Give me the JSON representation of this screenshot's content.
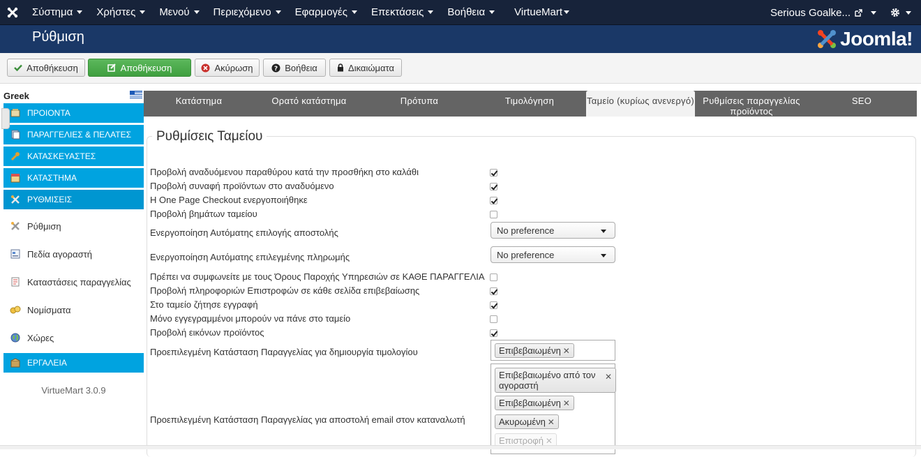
{
  "topnav": {
    "menu": [
      "Σύστημα",
      "Χρήστες",
      "Μενού",
      "Περιεχόμενο",
      "Εφαρμογές",
      "Επεκτάσεις",
      "Βοήθεια",
      "VirtueMart"
    ],
    "user": "Serious Goalke...",
    "icons": [
      "joomla-icon",
      "external-link-icon",
      "gear-icon"
    ]
  },
  "header": {
    "title": "Ρύθμιση",
    "brand": "Joomla!"
  },
  "toolbar": {
    "apply": "Αποθήκευση",
    "save": "Αποθήκευση",
    "cancel": "Ακύρωση",
    "help": "Βοήθεια",
    "permissions": "Δικαιώματα"
  },
  "sidebar": {
    "language": "Greek",
    "sections": {
      "products": "ΠΡΟΙΟΝΤΑ",
      "orders": "ΠΑΡΑΓΓΕΛΙΕΣ & ΠΕΛΑΤΕΣ",
      "manufacturers": "ΚΑΤΑΣΚΕΥΑΣΤΕΣ",
      "shop": "ΚΑΤΑΣΤΗΜΑ",
      "settings": "ΡΥΘΜΙΣΕΙΣ",
      "tools": "ΕΡΓΑΛΕΙΑ"
    },
    "items": [
      "Ρύθμιση",
      "Πεδία αγοραστή",
      "Καταστάσεις παραγγελίας",
      "Νομίσματα",
      "Χώρες"
    ],
    "version": "VirtueMart 3.0.9"
  },
  "tabs": [
    "Κατάστημα",
    "Ορατό κατάστημα",
    "Πρότυπα",
    "Τιμολόγηση",
    "Ταμείο (κυρίως ανενεργό)",
    "Ρυθμίσεις παραγγελίας προϊόντος",
    "SEO"
  ],
  "active_tab": 4,
  "content": {
    "legend": "Ρυθμίσεις Ταμείου",
    "rows": [
      {
        "label": "Προβολή αναδυόμενου παραθύρου κατά την προσθήκη στο καλάθι",
        "checked": true
      },
      {
        "label": "Προβολή συναφή προϊόντων στο αναδυόμενο",
        "checked": true
      },
      {
        "label": "Η One Page Checkout ενεργοποιήθηκε",
        "checked": true
      },
      {
        "label": "Προβολή βημάτων ταμείου",
        "checked": false
      },
      {
        "label": "Ενεργοποίηση Αυτόματης επιλογής αποστολής",
        "select": "No preference"
      },
      {
        "label": "Ενεργοποίηση Αυτόματης επιλεγμένης πληρωμής",
        "select": "No preference"
      },
      {
        "label": "Πρέπει να συμφωνείτε με τους Όρους Παροχής Υπηρεσιών σε ΚΑΘΕ ΠΑΡΑΓΓΕΛΙΑ",
        "checked": false
      },
      {
        "label": "Προβολή πληροφοριών Επιστροφών σε κάθε σελίδα επιβεβαίωσης",
        "checked": true
      },
      {
        "label": "Στο ταμείο ζήτησε εγγραφή",
        "checked": true
      },
      {
        "label": "Μόνο εγγεγραμμένοι μπορούν να πάνε στο ταμείο",
        "checked": false
      },
      {
        "label": "Προβολή εικόνων προϊόντος",
        "checked": true
      }
    ],
    "invoice_status": {
      "label": "Προεπιλεγμένη Κατάσταση Παραγγελίας για δημιουργία τιμολογίου",
      "chips": [
        "Επιβεβαιωμένη"
      ]
    },
    "email_status": {
      "label": "Προεπιλεγμένη Κατάσταση Παραγγελίας για αποστολή email στον καταναλωτή",
      "chips": [
        "Επιβεβαιωμένο από τον αγοραστή",
        "Επιβεβαιωμένη",
        "Ακυρωμένη",
        "Επιστροφή"
      ]
    }
  }
}
